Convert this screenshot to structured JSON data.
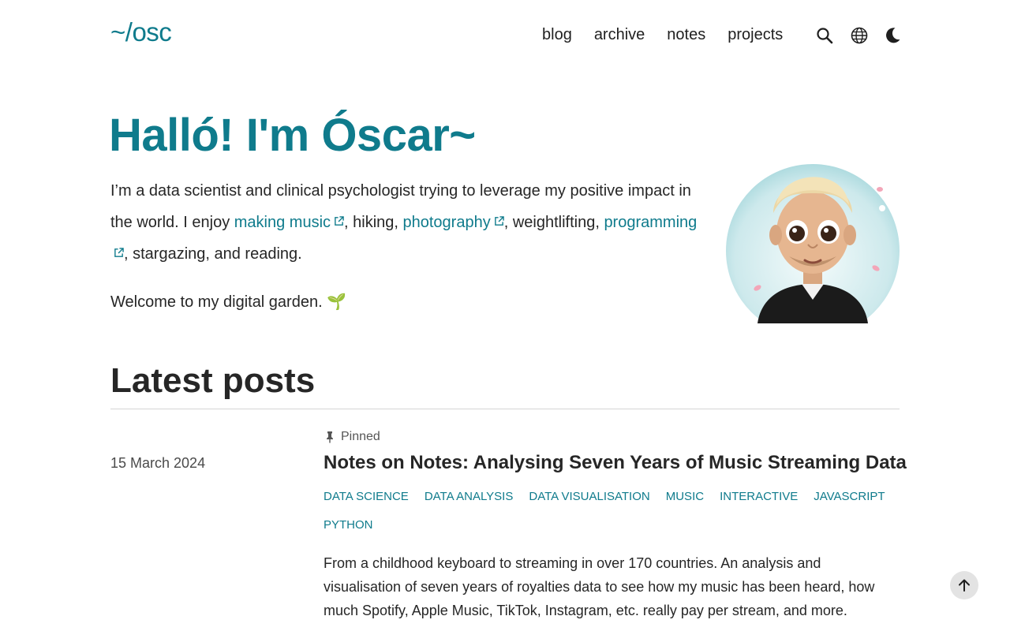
{
  "header": {
    "logo": "~/osc",
    "nav": [
      "blog",
      "archive",
      "notes",
      "projects"
    ],
    "icons": [
      "search-icon",
      "globe-icon",
      "moon-icon"
    ]
  },
  "hero": {
    "title": "Halló! I'm Óscar~",
    "intro_pre": "I’m a data scientist and clinical psychologist trying to leverage my positive impact in the world. I enjoy ",
    "link_music": "making music",
    "sep1": ", hiking, ",
    "link_photography": "photography",
    "sep2": ", weightlifting, ",
    "link_programming": "programming",
    "intro_post": ", stargazing, and reading.",
    "welcome": "Welcome to my digital garden.",
    "welcome_emoji": "🌱"
  },
  "posts": {
    "heading": "Latest posts",
    "items": [
      {
        "pinned_label": "Pinned",
        "date": "15 March 2024",
        "title": "Notes on Notes: Analysing Seven Years of Music Streaming Data",
        "tags": [
          "Data science",
          "Data analysis",
          "Data visualisation",
          "Music",
          "Interactive",
          "JavaScript",
          "Python"
        ],
        "excerpt": "From a childhood keyboard to streaming in over 170 countries. An analysis and visualisation of seven years of royalties data to see how my music has been heard, how much Spotify, Apple Music, TikTok, Instagram, etc. really pay per stream, and more."
      }
    ]
  },
  "colors": {
    "accent": "#0f7b8c",
    "text": "#262626",
    "rule": "#d4d4d4"
  }
}
